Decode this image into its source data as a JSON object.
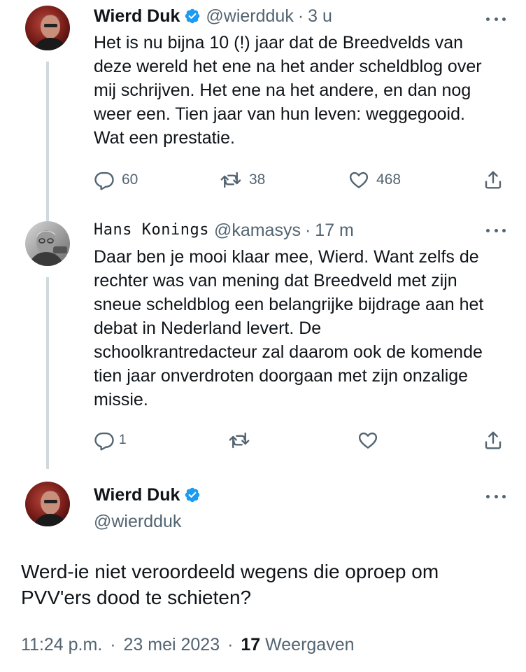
{
  "tweet1": {
    "name": "Wierd Duk",
    "handle": "@wierdduk",
    "separator": "·",
    "time": "3 u",
    "text_lines": [
      "Het is nu bijna 10 (!)  jaar dat de Breedvelds van",
      "deze wereld het ene na het ander scheldblog over",
      "mij schrijven. Het ene na het andere, en dan nog",
      "weer een. Tien jaar van hun leven: weggegooid.",
      "Wat een prestatie."
    ],
    "replies": "60",
    "reposts": "38",
    "likes": "468"
  },
  "tweet2": {
    "name": "Hans Konings",
    "handle": "@kamasys",
    "separator": "·",
    "time": "17 m",
    "text_lines": [
      "Daar ben je mooi klaar mee, Wierd. Want zelfs de",
      "rechter was van mening dat Breedveld met zijn",
      "sneue scheldblog een belangrijke bijdrage aan het",
      "debat in Nederland levert. De",
      "schoolkrantredacteur zal daarom ook de komende",
      "tien jaar onverdroten doorgaan met zijn onzalige",
      "missie."
    ],
    "replies": "1"
  },
  "tweet3": {
    "name": "Wierd Duk",
    "handle": "@wierdduk",
    "text_lines": [
      "Werd-ie niet veroordeeld wegens die oproep om",
      "PVV'ers dood te schieten?"
    ],
    "time": "11:24 p.m.",
    "separator": "·",
    "date": "23 mei 2023",
    "views_count": "17",
    "views_label": "Weergaven"
  },
  "colors": {
    "text": "#0f1419",
    "secondary": "#536471",
    "verified": "#1d9bf0",
    "thread_line": "#cfd9de"
  },
  "icons": [
    "verified-badge-icon",
    "more-icon",
    "reply-icon",
    "repost-icon",
    "like-icon",
    "share-icon"
  ]
}
